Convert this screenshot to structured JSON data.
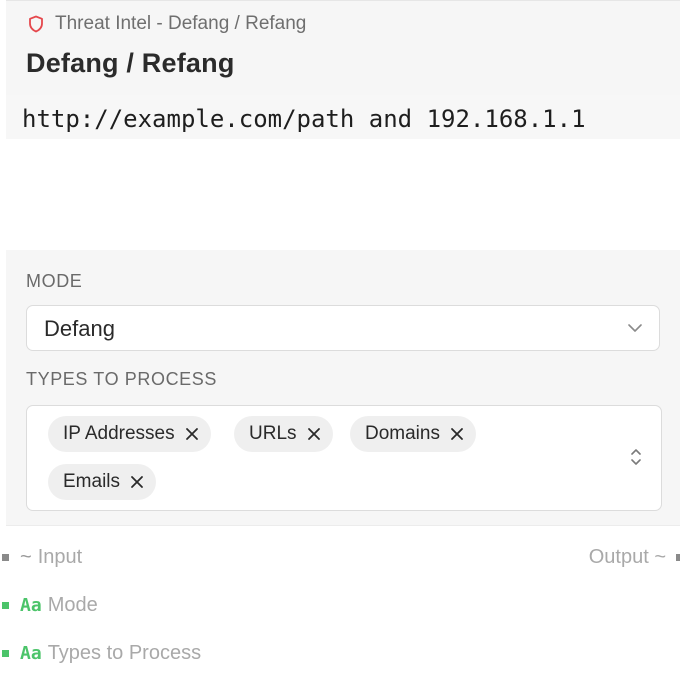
{
  "header": {
    "breadcrumb": "Threat Intel - Defang / Refang",
    "title": "Defang / Refang"
  },
  "input": {
    "value": "http://example.com/path and 192.168.1.1"
  },
  "mode": {
    "label": "MODE",
    "value": "Defang"
  },
  "types": {
    "label": "TYPES TO PROCESS",
    "chips": [
      "IP Addresses",
      "URLs",
      "Domains",
      "Emails"
    ]
  },
  "io": {
    "input_label": "Input",
    "output_label": "Output ~",
    "mode_label": "Mode",
    "types_label": "Types to Process",
    "tilde": "~",
    "text_type": "Aa"
  },
  "colors": {
    "accent_green": "#4cc46a",
    "shield_red": "#e5484d",
    "handle_gray": "#8a8a8a"
  },
  "icons": {
    "breadcrumb": "shield-icon",
    "select": "chevron-down-icon",
    "chip_remove": "close-icon",
    "multiselect": "updown-chevron-icon"
  }
}
